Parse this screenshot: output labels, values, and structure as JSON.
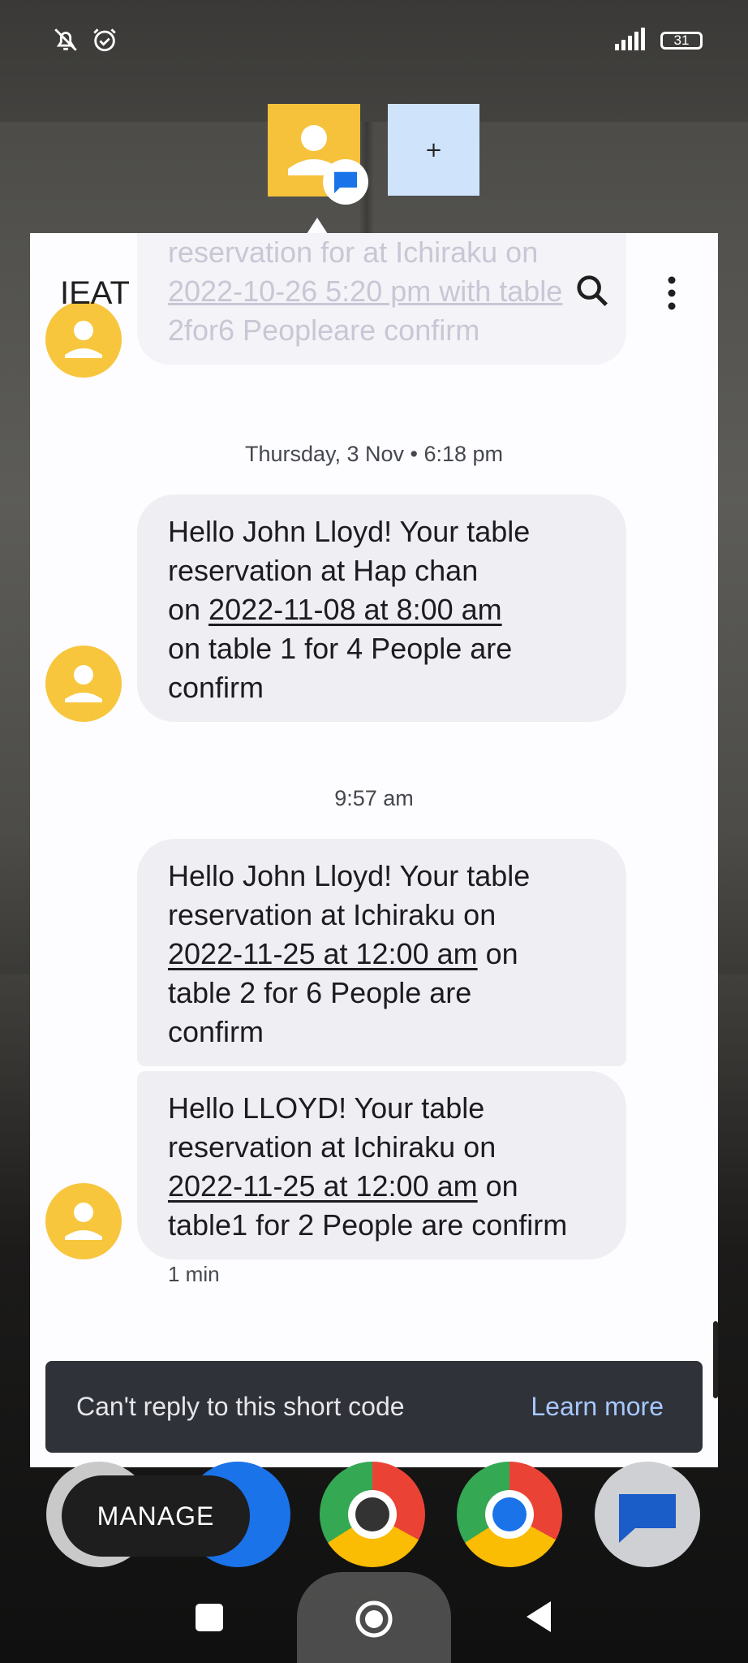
{
  "status_bar": {
    "left_icons": [
      "bell-off-icon",
      "alarm-icon"
    ],
    "signal_icon": "signal-icon",
    "battery_level": "31"
  },
  "bubbles": {
    "contact_avatar_icon": "person-icon",
    "badge_icon": "messages-icon",
    "add_label": "+"
  },
  "header": {
    "title": "IEAT",
    "search_icon": "search-icon",
    "more_icon": "more-vert-icon"
  },
  "conversation": {
    "faded_message": {
      "lines": [
        "reservation for at Ichiraku on",
        "2022-10-26 5:20 pm with table",
        "2for6 Peopleare confirm"
      ]
    },
    "timestamp_1": "Thursday, 3 Nov • 6:18 pm",
    "message_1": {
      "line1": "Hello John Lloyd! Your table",
      "line2": "reservation at Hap chan",
      "line3_pre": "on ",
      "line3_link": "2022-11-08 at 8:00 am",
      "line4": "on table 1 for 4 People are",
      "line5": "confirm"
    },
    "timestamp_2": "9:57 am",
    "message_2": {
      "line1": "Hello John Lloyd! Your table",
      "line2": "reservation at Ichiraku on",
      "line3_link": "2022-11-25 at 12:00 am",
      "line3_post": " on",
      "line4": "table 2 for 6 People are",
      "line5": "confirm"
    },
    "message_3": {
      "line1": "Hello LLOYD! Your table",
      "line2": "reservation at Ichiraku on",
      "line3_link": "2022-11-25 at 12:00 am",
      "line3_post": " on",
      "line4": "table1 for 2 People are confirm"
    },
    "meta": "1 min"
  },
  "snackbar": {
    "text": "Can't reply to this short code",
    "action": "Learn more"
  },
  "dock": {
    "manage_label": "MANAGE"
  },
  "nav": {
    "recent_icon": "recent-apps-icon",
    "home_icon": "home-icon",
    "back_icon": "back-icon"
  },
  "colors": {
    "avatar": "#f7c63d",
    "bubble": "#efeef3",
    "snackbar": "#30323a",
    "snackbar_action": "#a6c8ff"
  }
}
